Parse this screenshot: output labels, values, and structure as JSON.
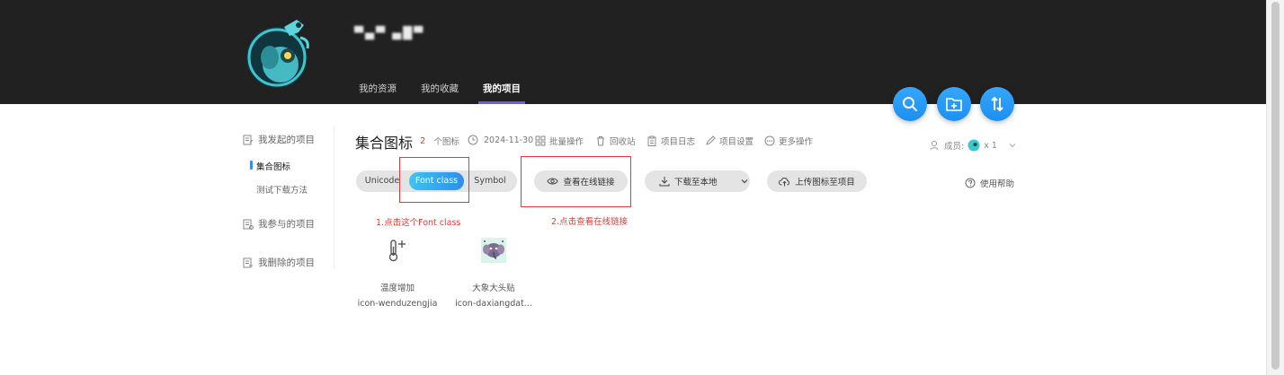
{
  "header": {
    "username": "▀▄▀ ▄█▀",
    "nav_tabs": [
      {
        "label": "我的资源",
        "active": false
      },
      {
        "label": "我的收藏",
        "active": false
      },
      {
        "label": "我的项目",
        "active": true
      }
    ],
    "fabs": [
      "search-icon",
      "add-folder-icon",
      "sort-icon"
    ],
    "accent_color": "#1d8fef"
  },
  "sidebar": {
    "groups": [
      {
        "label": "我发起的项目",
        "items": [
          {
            "label": "集合图标",
            "active": true
          },
          {
            "label": "测试下载方法",
            "active": false
          }
        ]
      },
      {
        "label": "我参与的项目",
        "items": []
      },
      {
        "label": "我删除的项目",
        "items": []
      }
    ]
  },
  "project": {
    "title": "集合图标",
    "icon_count": "2",
    "icon_count_unit": "个图标",
    "date": "2024-11-30",
    "actions": [
      "批量操作",
      "回收站",
      "项目日志",
      "项目设置",
      "更多操作"
    ],
    "members_label": "成员:",
    "members_count": "x 1"
  },
  "toolbar": {
    "formats": [
      {
        "label": "Unicode",
        "active": false
      },
      {
        "label": "Font class",
        "active": true
      },
      {
        "label": "Symbol",
        "active": false
      }
    ],
    "view_online": "查看在线链接",
    "download": "下载至本地",
    "upload": "上传图标至项目",
    "help": "使用帮助"
  },
  "annotations": {
    "step1": "1.点击这个Font class",
    "step2": "2.点击查看在线链接",
    "color": "#e53935"
  },
  "icons": [
    {
      "name": "温度增加",
      "code": "icon-wenduzengjia"
    },
    {
      "name": "大象大头贴",
      "code": "icon-daxiangdat..."
    }
  ]
}
